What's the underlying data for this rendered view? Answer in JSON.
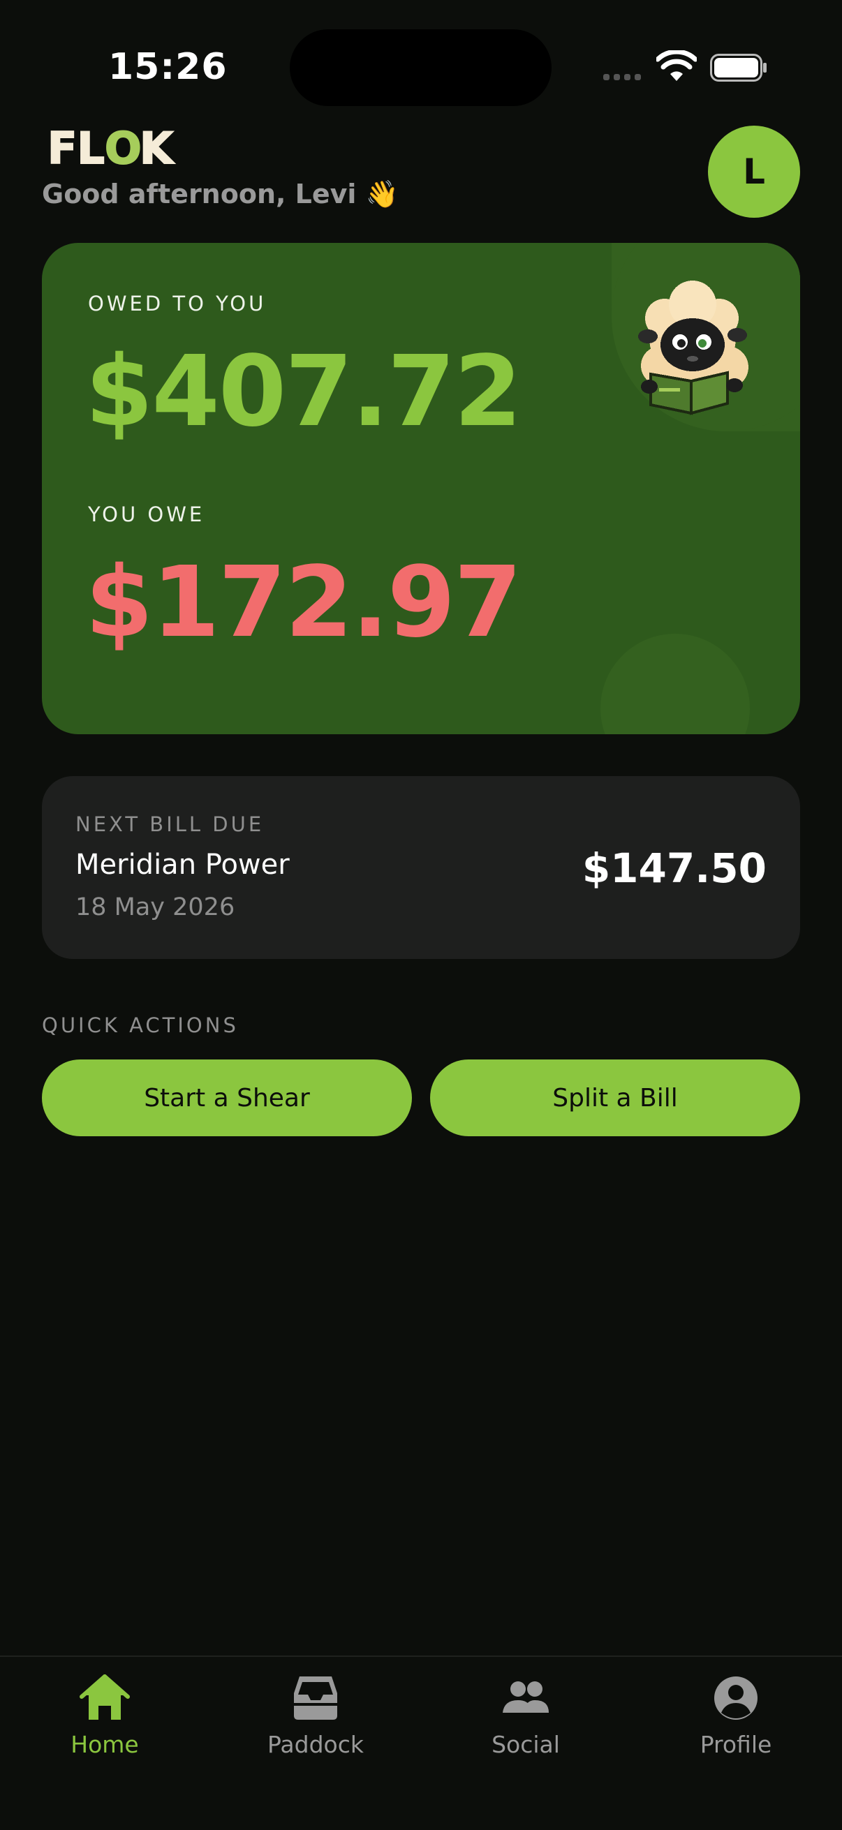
{
  "status_bar": {
    "time": "15:26"
  },
  "header": {
    "logo_text": "FLOK",
    "greeting": "Good afternoon, Levi 👋",
    "avatar_initial": "L"
  },
  "balances": {
    "owed_label": "OWED TO YOU",
    "owed_amount": "$407.72",
    "owe_label": "YOU OWE",
    "owe_amount": "$172.97",
    "mascot_icon": "sheep-reading-icon"
  },
  "next_bill": {
    "label": "NEXT BILL DUE",
    "name": "Meridian Power",
    "date": "18 May 2026",
    "amount": "$147.50"
  },
  "quick_actions": {
    "label": "QUICK ACTIONS",
    "buttons": [
      {
        "label": "Start a Shear"
      },
      {
        "label": "Split a Bill"
      }
    ]
  },
  "tabs": [
    {
      "label": "Home",
      "icon": "home-icon",
      "active": true
    },
    {
      "label": "Paddock",
      "icon": "inbox-icon",
      "active": false
    },
    {
      "label": "Social",
      "icon": "people-icon",
      "active": false
    },
    {
      "label": "Profile",
      "icon": "person-circle-icon",
      "active": false
    }
  ],
  "colors": {
    "accent": "#8bc63f",
    "owe": "#f26d6d",
    "card": "#2e5a1c",
    "background": "#0c0e0b"
  }
}
